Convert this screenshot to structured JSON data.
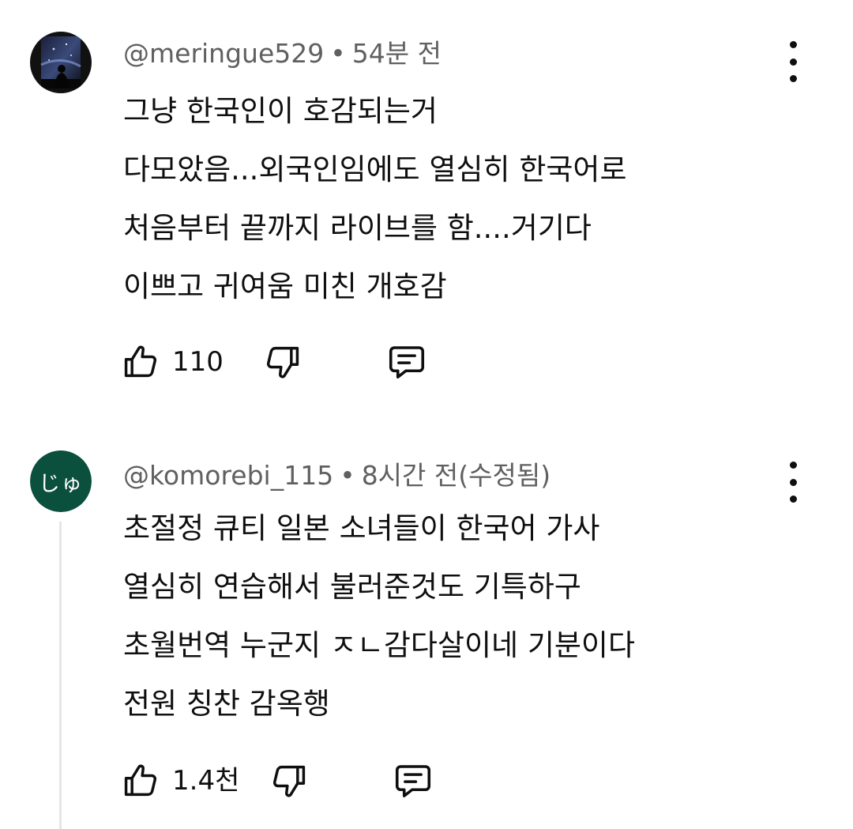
{
  "comments": [
    {
      "author": "@meringue529",
      "separator": "•",
      "time": "54분 전",
      "lines": [
        "그냥 한국인이 호감되는거",
        "다모았음...외국인임에도 열심히 한국어로",
        "처음부터 끝까지 라이브를 함....거기다",
        "이쁘고 귀여움 미친 개호감"
      ],
      "likes": "110",
      "avatar_icon": "night-sky-photo-icon"
    },
    {
      "author": "@komorebi_115",
      "separator": "•",
      "time": "8시간 전(수정됨)",
      "avatar_text": "じゅ",
      "avatar_color": "#0b4f3d",
      "lines": [
        "초절정 큐티 일본 소녀들이 한국어 가사",
        "열심히 연습해서 불러준것도 기특하구",
        "초월번역 누군지 ㅈㄴ감다살이네 기분이다",
        "전원 칭찬 감옥행"
      ],
      "likes": "1.4천"
    }
  ],
  "icons": {
    "like": "thumbs-up-icon",
    "dislike": "thumbs-down-icon",
    "reply": "reply-comment-icon",
    "more": "more-vertical-icon"
  }
}
